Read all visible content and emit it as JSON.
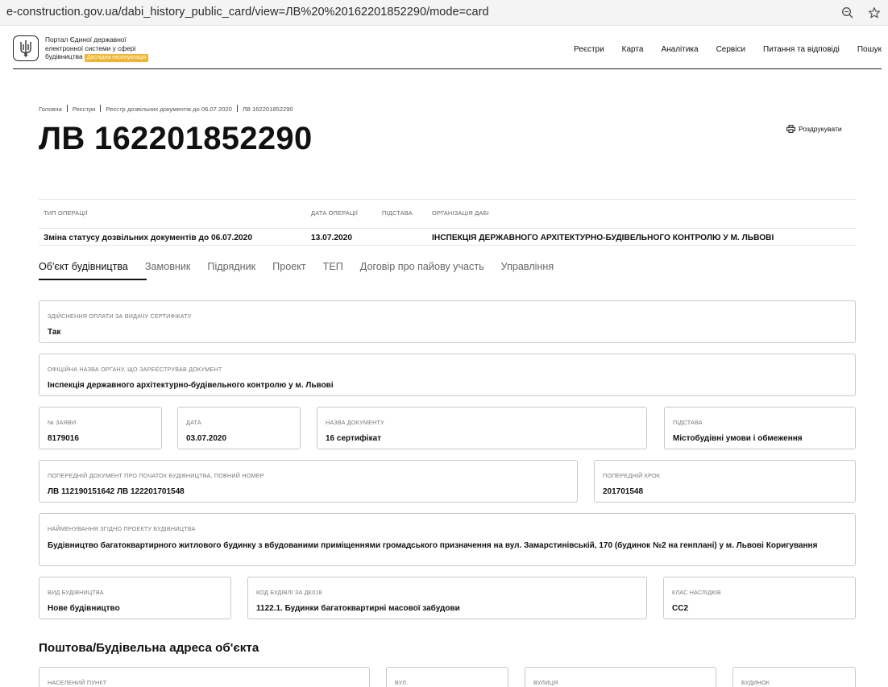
{
  "browser": {
    "url": "e-construction.gov.ua/dabi_history_public_card/view=ЛВ%20%20162201852290/mode=card",
    "zoom_icon": "zoom-out-icon",
    "bookmark_icon": "star-icon"
  },
  "header": {
    "logo_line1": "Портал Єдиної державної",
    "logo_line2": "електронної системи у сфері",
    "logo_line3": "будівництва",
    "badge": "Дослідна експлуатація",
    "nav": [
      "Реєстри",
      "Карта",
      "Аналітика",
      "Сервіси",
      "Питання та відповіді",
      "Пошук"
    ]
  },
  "breadcrumb": [
    "Головна",
    "Реєстри",
    "Реєстр дозвільних документів до 06.07.2020",
    "ЛВ 162201852290"
  ],
  "page_title": "ЛВ 162201852290",
  "print_label": "Роздрукувати",
  "operation": {
    "headers": [
      "ТИП ОПЕРАЦІЇ",
      "ДАТА ОПЕРАЦІЇ",
      "ПІДСТАВА",
      "ОРГАНІЗАЦІЯ ДАБІ"
    ],
    "type": "Зміна статусу дозвільних документів до 06.07.2020",
    "date": "13.07.2020",
    "basis": "",
    "org": "ІНСПЕКЦІЯ ДЕРЖАВНОГО АРХІТЕКТУРНО-БУДІВЕЛЬНОГО КОНТРОЛЮ У М. ЛЬВОВІ"
  },
  "tabs": [
    "Об'єкт будівництва",
    "Замовник",
    "Підрядник",
    "Проект",
    "ТЕП",
    "Договір про пайову участь",
    "Управління"
  ],
  "fields": {
    "payment": {
      "label": "ЗДІЙСНЕННЯ ОПЛАТИ ЗА ВИДАЧУ СЕРТИФІКАТУ",
      "value": "Так"
    },
    "org_name": {
      "label": "ОФІЦІЙНА НАЗВА ОРГАНУ, ЩО ЗАРЕЄСТРУВАВ ДОКУМЕНТ",
      "value": "Інспекція державного архітектурно-будівельного контролю у м. Львові"
    },
    "app_no": {
      "label": "№ ЗАЯВИ",
      "value": "8179016"
    },
    "date": {
      "label": "ДАТА",
      "value": "03.07.2020"
    },
    "doc_name": {
      "label": "НАЗВА ДОКУМЕНТУ",
      "value": "16 сертифікат"
    },
    "basis": {
      "label": "ПІДСТАВА",
      "value": "Містобудівні умови і обмеження"
    },
    "prev_doc": {
      "label": "ПОПЕРЕДНІЙ ДОКУМЕНТ ПРО ПОЧАТОК БУДІВНИЦТВА, ПОВНИЙ НОМЕР",
      "value": "ЛВ 112190151642 ЛВ 122201701548"
    },
    "prev_step": {
      "label": "ПОПЕРЕДНІЙ КРОК",
      "value": "201701548"
    },
    "project_name": {
      "label": "НАЙМЕНУВАННЯ ЗГІДНО ПРОЕКТУ БУДІВНИЦТВА",
      "value": "Будівництво багатоквартирного житлового будинку з вбудованими приміщеннями громадського призначення на вул. Замарстинівській, 170 (будинок №2 на генплані) у м. Львові Коригування"
    },
    "build_type": {
      "label": "ВИД БУДІВНИЦТВА",
      "value": "Нове будівництво"
    },
    "building_code": {
      "label": "КОД БУДІВЛІ ЗА ДК018",
      "value": "1122.1. Будинки багатоквартирні масової забудови"
    },
    "consequence_class": {
      "label": "КЛАС НАСЛІДКІВ",
      "value": "СС2"
    }
  },
  "address_section": {
    "title": "Поштова/Будівельна адреса об'єкта",
    "labels": [
      "НАСЕЛЕНИЙ ПУНКТ",
      "ВУЛ.",
      "ВУЛИЦЯ",
      "БУДИНОК"
    ]
  }
}
